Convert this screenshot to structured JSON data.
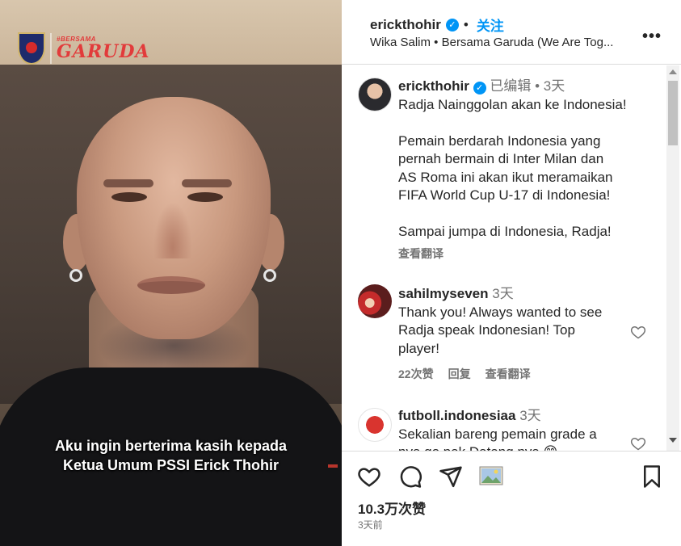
{
  "video": {
    "logo_small_text": "#BERSAMA",
    "logo_big_text": "GARUDA",
    "caption_line1": "Aku ingin berterima kasih kepada",
    "caption_line2": "Ketua Umum PSSI Erick Thohir"
  },
  "header": {
    "username": "erickthohir",
    "follow_label": "关注",
    "subtitle": "Wika Salim • Bersama Garuda (We Are Tog...",
    "more_label": "•••"
  },
  "post": {
    "username": "erickthohir",
    "edited": "已编辑",
    "time": "3天",
    "lines": [
      "Radja Nainggolan akan ke Indonesia!",
      "",
      "Pemain berdarah Indonesia yang",
      "pernah bermain di Inter Milan dan",
      "AS Roma ini akan ikut meramaikan",
      "FIFA World Cup U-17 di Indonesia!",
      "",
      "Sampai jumpa di Indonesia, Radja!"
    ],
    "translate_label": "查看翻译"
  },
  "comments": [
    {
      "username": "sahilmyseven",
      "time": "3天",
      "lines": [
        "Thank you! Always wanted to see",
        "Radja speak Indonesian! Top",
        "player!"
      ],
      "likes": "22次赞",
      "reply": "回复",
      "translate": "查看翻译"
    },
    {
      "username": "futboll.indonesiaa",
      "time": "3天",
      "lines": [
        "Sekalian bareng pemain grade a",
        "nya go pak Datang nya 😁"
      ]
    }
  ],
  "footer": {
    "likes": "10.3万次赞",
    "ago": "3天前"
  },
  "icons": [
    "heart-icon",
    "comment-icon",
    "share-icon",
    "image-icon",
    "bookmark-icon",
    "verified-icon",
    "more-icon"
  ],
  "colors": {
    "accent": "#0095f6",
    "text": "#262626",
    "muted": "#737373"
  }
}
